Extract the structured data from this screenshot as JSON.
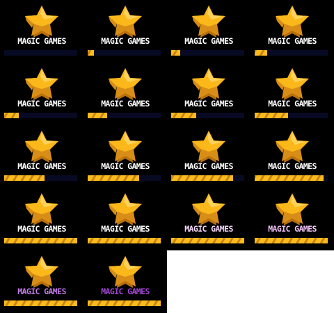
{
  "sheet": {
    "background": "#ffffff",
    "frame_background": "#000000",
    "bar_track_color": "#080a24",
    "bar_fill_color": "#fbbb1c",
    "bar_stripe_color": "#c8841a",
    "star_icon": "star-icon",
    "star_colors": {
      "light": "#fdd25a",
      "main": "#fbb81b",
      "shadow": "#d88e16",
      "dark": "#b8700e"
    }
  },
  "frames": [
    {
      "label": "MAGIC GAMES",
      "progress": 0,
      "text_color": "#ffffff"
    },
    {
      "label": "MAGIC GAMES",
      "progress": 9,
      "text_color": "#ffffff"
    },
    {
      "label": "MAGIC GAMES",
      "progress": 12,
      "text_color": "#ffffff"
    },
    {
      "label": "MAGIC GAMES",
      "progress": 17,
      "text_color": "#ffffff"
    },
    {
      "label": "MAGIC GAMES",
      "progress": 20,
      "text_color": "#ffffff"
    },
    {
      "label": "MAGIC GAMES",
      "progress": 27,
      "text_color": "#ffffff"
    },
    {
      "label": "MAGIC GAMES",
      "progress": 34,
      "text_color": "#ffffff"
    },
    {
      "label": "MAGIC GAMES",
      "progress": 46,
      "text_color": "#ffffff"
    },
    {
      "label": "MAGIC GAMES",
      "progress": 55,
      "text_color": "#ffffff"
    },
    {
      "label": "MAGIC GAMES",
      "progress": 70,
      "text_color": "#ffffff"
    },
    {
      "label": "MAGIC GAMES",
      "progress": 85,
      "text_color": "#ffffff"
    },
    {
      "label": "MAGIC GAMES",
      "progress": 94,
      "text_color": "#ffffff"
    },
    {
      "label": "MAGIC GAMES",
      "progress": 100,
      "text_color": "#ffffff"
    },
    {
      "label": "MAGIC GAMES",
      "progress": 100,
      "text_color": "#ffffff"
    },
    {
      "label": "MAGIC GAMES",
      "progress": 100,
      "text_color": "#f4d6f8"
    },
    {
      "label": "MAGIC GAMES",
      "progress": 100,
      "text_color": "#f0c0f4"
    },
    {
      "label": "MAGIC GAMES",
      "progress": 100,
      "text_color": "#c07ae4"
    },
    {
      "label": "MAGIC GAMES",
      "progress": 100,
      "text_color": "#a246d4"
    }
  ]
}
